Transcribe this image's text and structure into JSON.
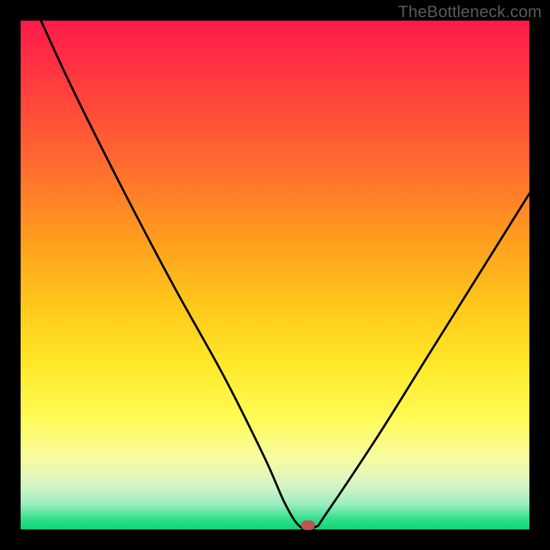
{
  "watermark": "TheBottleneck.com",
  "chart_data": {
    "type": "line",
    "title": "",
    "xlabel": "",
    "ylabel": "",
    "xlim": [
      0,
      100
    ],
    "ylim": [
      0,
      100
    ],
    "grid": false,
    "legend": false,
    "series": [
      {
        "name": "bottleneck-curve",
        "x": [
          4,
          10,
          20,
          30,
          40,
          48,
          52,
          55,
          58,
          60,
          70,
          80,
          90,
          100
        ],
        "y": [
          100,
          87,
          67,
          48,
          30,
          14,
          5,
          0.5,
          0.5,
          3,
          18,
          34,
          50,
          66
        ]
      }
    ],
    "marker": {
      "x": 56.5,
      "y": 0.8,
      "color": "#c0544e"
    },
    "gradient_stops": [
      {
        "pos": 0,
        "color": "#ff1a4b"
      },
      {
        "pos": 50,
        "color": "#ffd21f"
      },
      {
        "pos": 100,
        "color": "#0fd674"
      }
    ]
  }
}
